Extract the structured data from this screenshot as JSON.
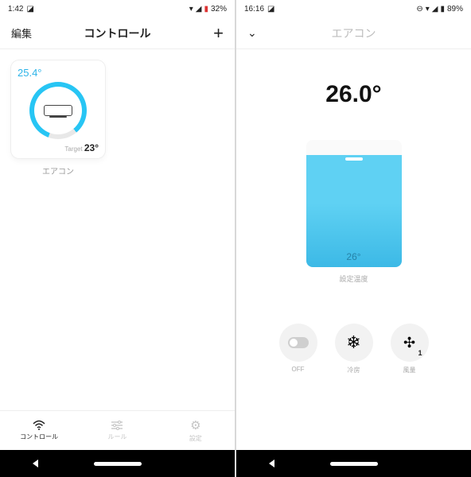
{
  "left": {
    "status": {
      "time": "1:42",
      "battery": "32%"
    },
    "header": {
      "left": "編集",
      "title": "コントロール"
    },
    "device": {
      "current": "25.4°",
      "target_label": "Target",
      "target_value": "23°",
      "name": "エアコン"
    },
    "tabs": [
      {
        "label": "コントロール",
        "icon": "wifi"
      },
      {
        "label": "ルール",
        "icon": "sliders"
      },
      {
        "label": "設定",
        "icon": "gear"
      }
    ]
  },
  "right": {
    "status": {
      "time": "16:16",
      "battery": "89%"
    },
    "header": {
      "title": "エアコン"
    },
    "current_temp": "26.0°",
    "slider": {
      "value": "26°",
      "caption": "設定温度"
    },
    "controls": {
      "power": {
        "label": "OFF"
      },
      "mode": {
        "label": "冷房"
      },
      "fan": {
        "label": "風量",
        "badge": "1"
      }
    }
  }
}
